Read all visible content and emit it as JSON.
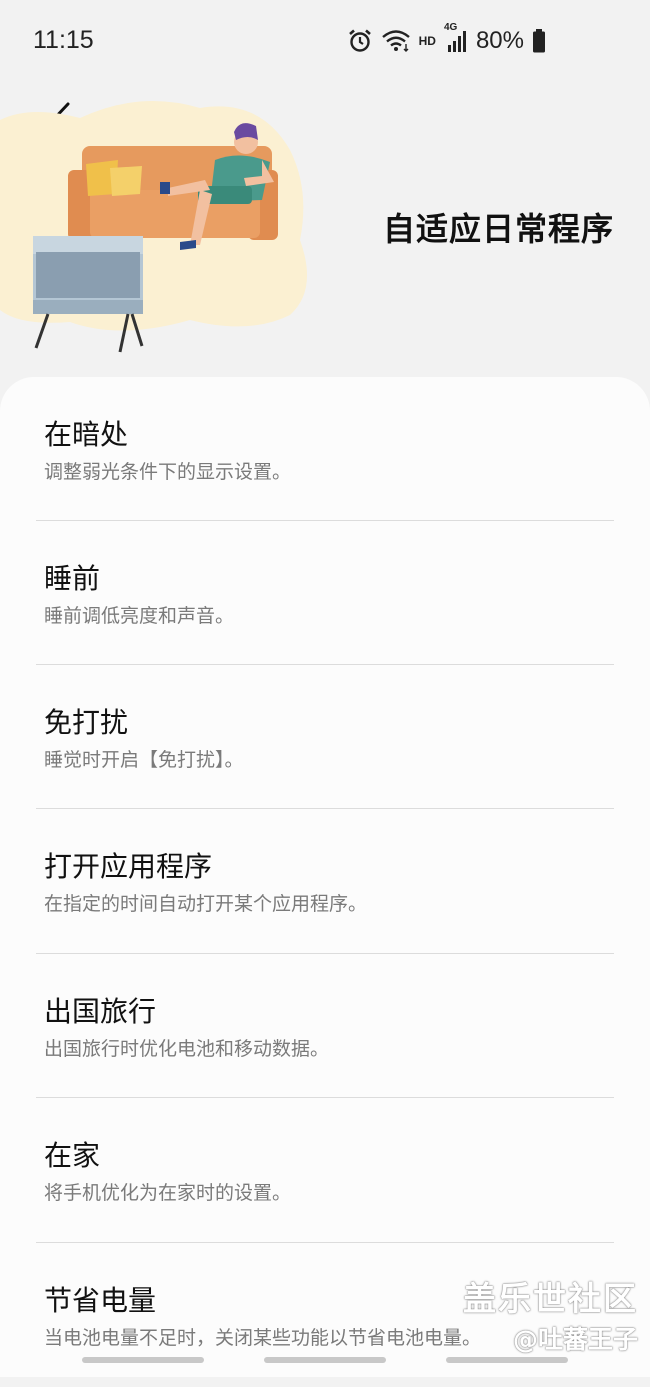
{
  "status_bar": {
    "time": "11:15",
    "hd": "HD",
    "network": "4G",
    "battery": "80%",
    "icons": [
      "alarm-icon",
      "wifi-icon",
      "signal-icon",
      "battery-icon"
    ]
  },
  "header": {
    "back_icon": "chevron-left-icon",
    "title": "自适应日常程序",
    "illustration": "person-on-sofa-with-tv"
  },
  "routines": [
    {
      "title": "在暗处",
      "description": "调整弱光条件下的显示设置。"
    },
    {
      "title": "睡前",
      "description": "睡前调低亮度和声音。"
    },
    {
      "title": "免打扰",
      "description": "睡觉时开启【免打扰】。"
    },
    {
      "title": "打开应用程序",
      "description": "在指定的时间自动打开某个应用程序。"
    },
    {
      "title": "出国旅行",
      "description": "出国旅行时优化电池和移动数据。"
    },
    {
      "title": "在家",
      "description": "将手机优化为在家时的设置。"
    },
    {
      "title": "节省电量",
      "description": "当电池电量不足时，关闭某些功能以节省电池电量。"
    }
  ],
  "watermark": {
    "line1": "盖乐世社区",
    "line2": "@吐蕃王子"
  },
  "colors": {
    "background": "#f2f2f2",
    "card": "#fcfcfc",
    "sofa": "#e69a5e",
    "blob": "#fbf0d2",
    "tv": "#a9bccb"
  }
}
